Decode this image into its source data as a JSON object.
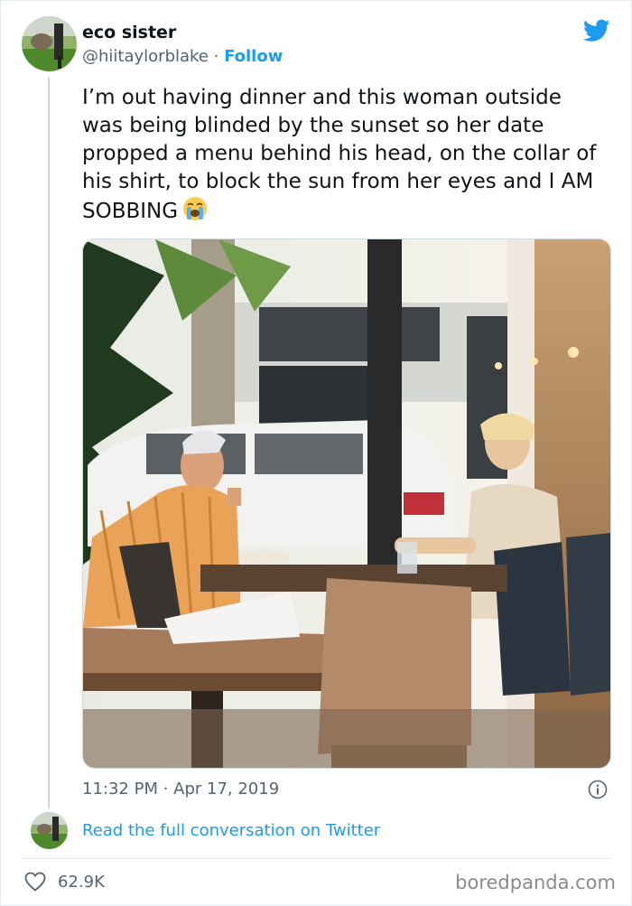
{
  "tweet": {
    "display_name": "eco sister",
    "handle": "@hiitaylorblake",
    "separator": " · ",
    "follow_label": "Follow",
    "text": "I’m out having dinner and this woman outside was being blinded by the sunset so her date propped a menu behind his head, on the collar of his shirt, to block the sun from her eyes and I AM SOBBING",
    "emoji": "loudly-crying-face-emoji",
    "timestamp": "11:32 PM · Apr 17, 2019",
    "read_more_label": "Read the full conversation on Twitter",
    "likes": "62.9K"
  },
  "watermark": "boredpanda.com",
  "icons": {
    "brand": "twitter-bird-icon",
    "info": "info-icon",
    "like": "heart-icon"
  },
  "colors": {
    "accent": "#1d9bf0",
    "secondary_text": "#536471",
    "border": "#e6ecf0"
  }
}
